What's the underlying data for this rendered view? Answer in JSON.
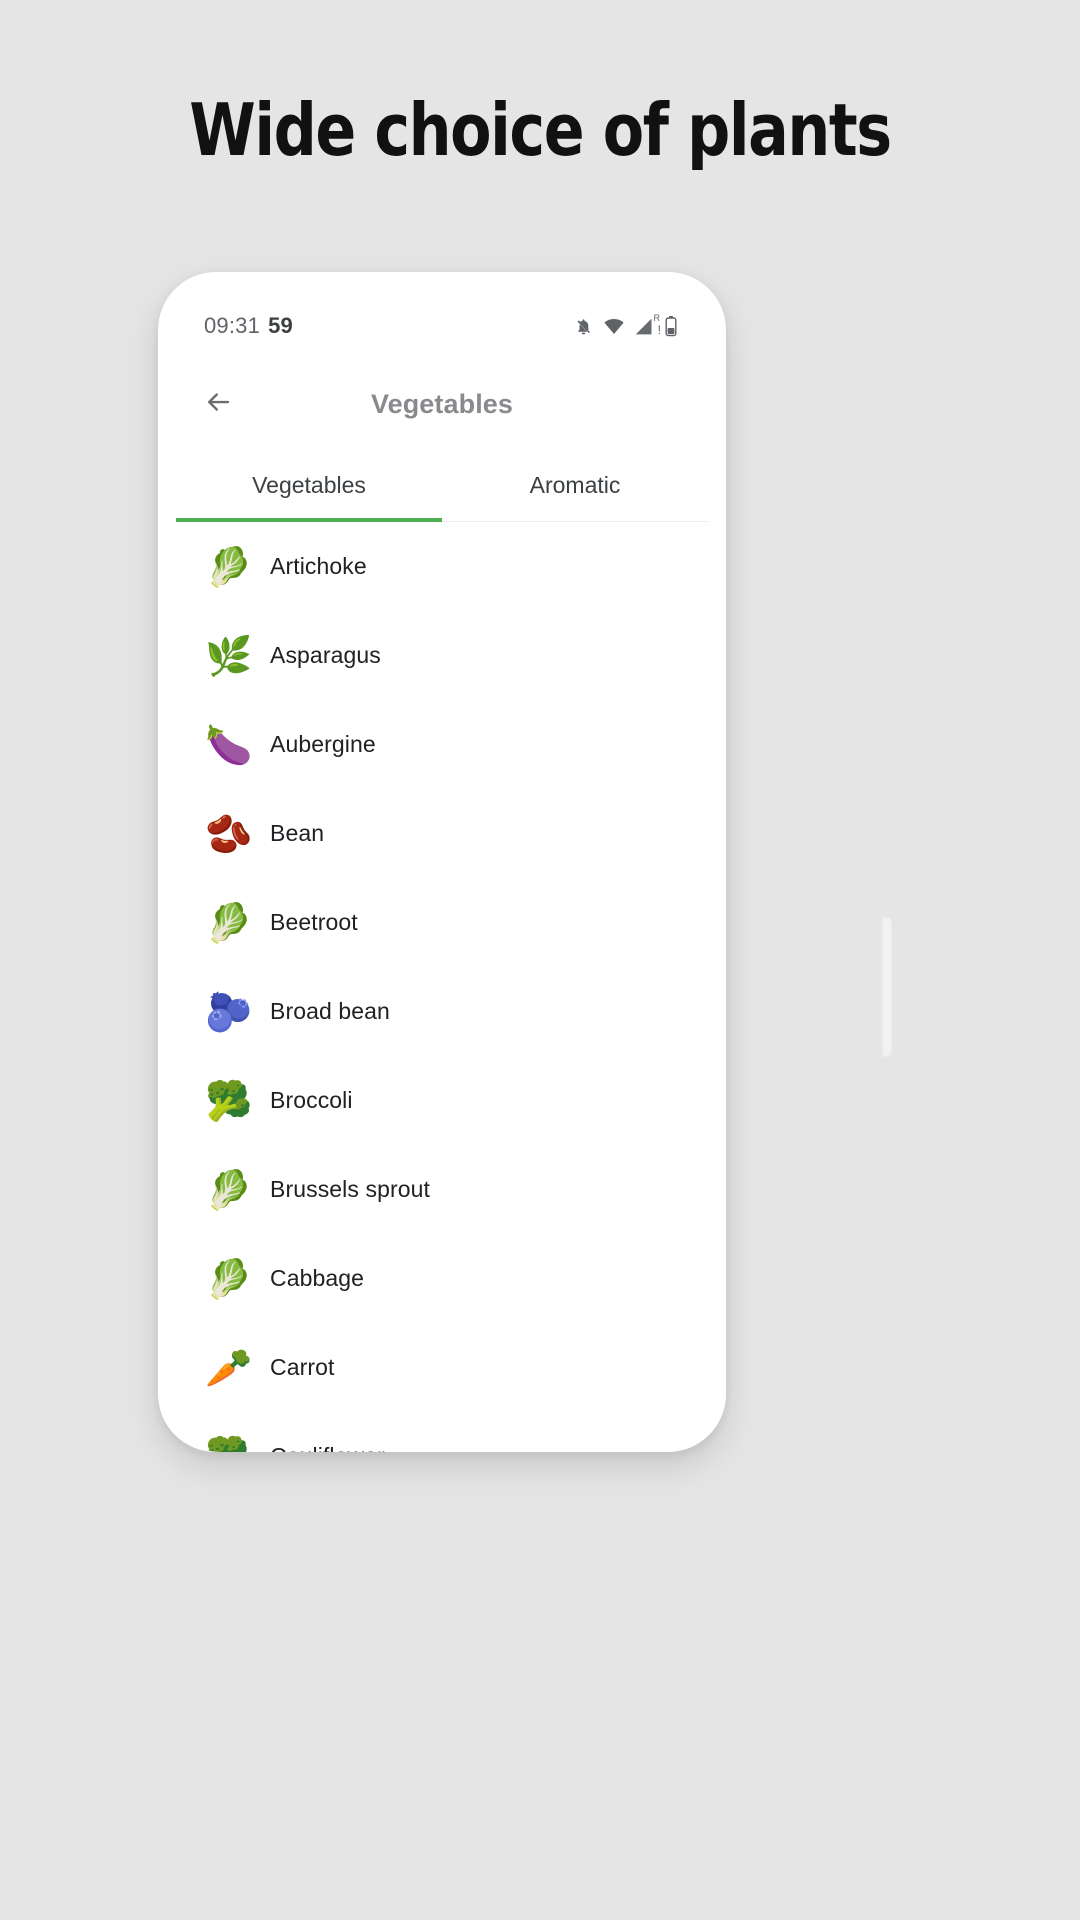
{
  "promo": {
    "heading": "Wide choice of plants"
  },
  "status_bar": {
    "time": "09:31",
    "seconds": "59",
    "icons": [
      {
        "name": "notifications-off-icon",
        "label": "notifications-off"
      },
      {
        "name": "wifi-icon",
        "label": "wifi"
      },
      {
        "name": "cellular-signal-icon",
        "label": "signal-roaming",
        "badge": "R"
      },
      {
        "name": "battery-icon",
        "label": "battery"
      }
    ]
  },
  "app_bar": {
    "back_icon": "arrow-back-icon",
    "title": "Vegetables"
  },
  "tabs": [
    {
      "label": "Vegetables",
      "active": true
    },
    {
      "label": "Aromatic",
      "active": false
    }
  ],
  "colors": {
    "accent": "#4caf50",
    "page_background": "#e5e5e5",
    "screen_background": "#ffffff",
    "title_text": "#8a8a8e",
    "list_text": "#202124"
  },
  "plants": [
    {
      "name": "Artichoke",
      "emoji": "🥬",
      "icon": "artichoke-icon"
    },
    {
      "name": "Asparagus",
      "emoji": "🌿",
      "icon": "asparagus-icon"
    },
    {
      "name": "Aubergine",
      "emoji": "🍆",
      "icon": "aubergine-icon"
    },
    {
      "name": "Bean",
      "emoji": "🫘",
      "icon": "bean-icon"
    },
    {
      "name": "Beetroot",
      "emoji": "🥬",
      "icon": "beetroot-icon"
    },
    {
      "name": "Broad bean",
      "emoji": "🫐",
      "icon": "broad-bean-icon"
    },
    {
      "name": "Broccoli",
      "emoji": "🥦",
      "icon": "broccoli-icon"
    },
    {
      "name": "Brussels sprout",
      "emoji": "🥬",
      "icon": "brussels-sprout-icon"
    },
    {
      "name": "Cabbage",
      "emoji": "🥬",
      "icon": "cabbage-icon"
    },
    {
      "name": "Carrot",
      "emoji": "🥕",
      "icon": "carrot-icon"
    },
    {
      "name": "Cauliflower",
      "emoji": "🥦",
      "icon": "cauliflower-icon"
    }
  ]
}
